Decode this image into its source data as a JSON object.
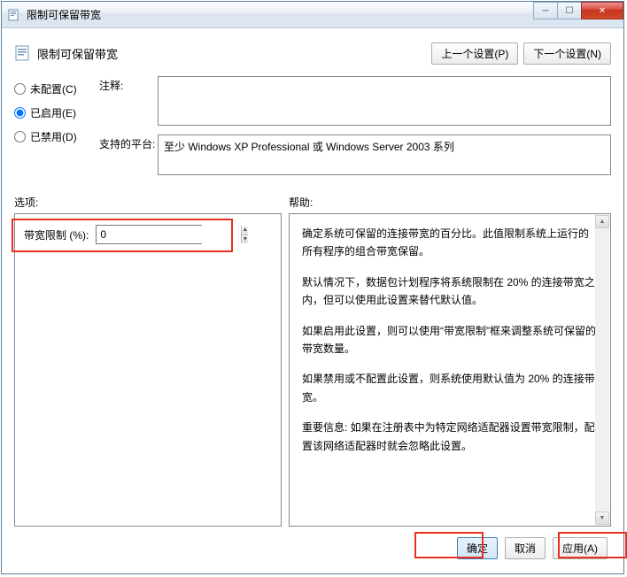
{
  "titlebar": {
    "title": "限制可保留带宽"
  },
  "header": {
    "title": "限制可保留带宽",
    "prev_btn": "上一个设置(P)",
    "next_btn": "下一个设置(N)"
  },
  "radios": {
    "not_configured": "未配置(C)",
    "enabled": "已启用(E)",
    "disabled": "已禁用(D)"
  },
  "fields": {
    "comment_label": "注释:",
    "comment_value": "",
    "platform_label": "支持的平台:",
    "platform_value": "至少 Windows XP Professional 或 Windows Server 2003 系列"
  },
  "sections": {
    "options_label": "选项:",
    "help_label": "帮助:"
  },
  "options": {
    "bandwidth_label": "带宽限制 (%):",
    "bandwidth_value": "0"
  },
  "help": {
    "p1": "确定系统可保留的连接带宽的百分比。此值限制系统上运行的所有程序的组合带宽保留。",
    "p2": "默认情况下，数据包计划程序将系统限制在 20% 的连接带宽之内，但可以使用此设置来替代默认值。",
    "p3": "如果启用此设置，则可以使用“带宽限制”框来调整系统可保留的带宽数量。",
    "p4": "如果禁用或不配置此设置，则系统使用默认值为 20% 的连接带宽。",
    "p5": "重要信息: 如果在注册表中为特定网络适配器设置带宽限制，配置该网络适配器时就会忽略此设置。"
  },
  "footer": {
    "ok": "确定",
    "cancel": "取消",
    "apply": "应用(A)"
  }
}
